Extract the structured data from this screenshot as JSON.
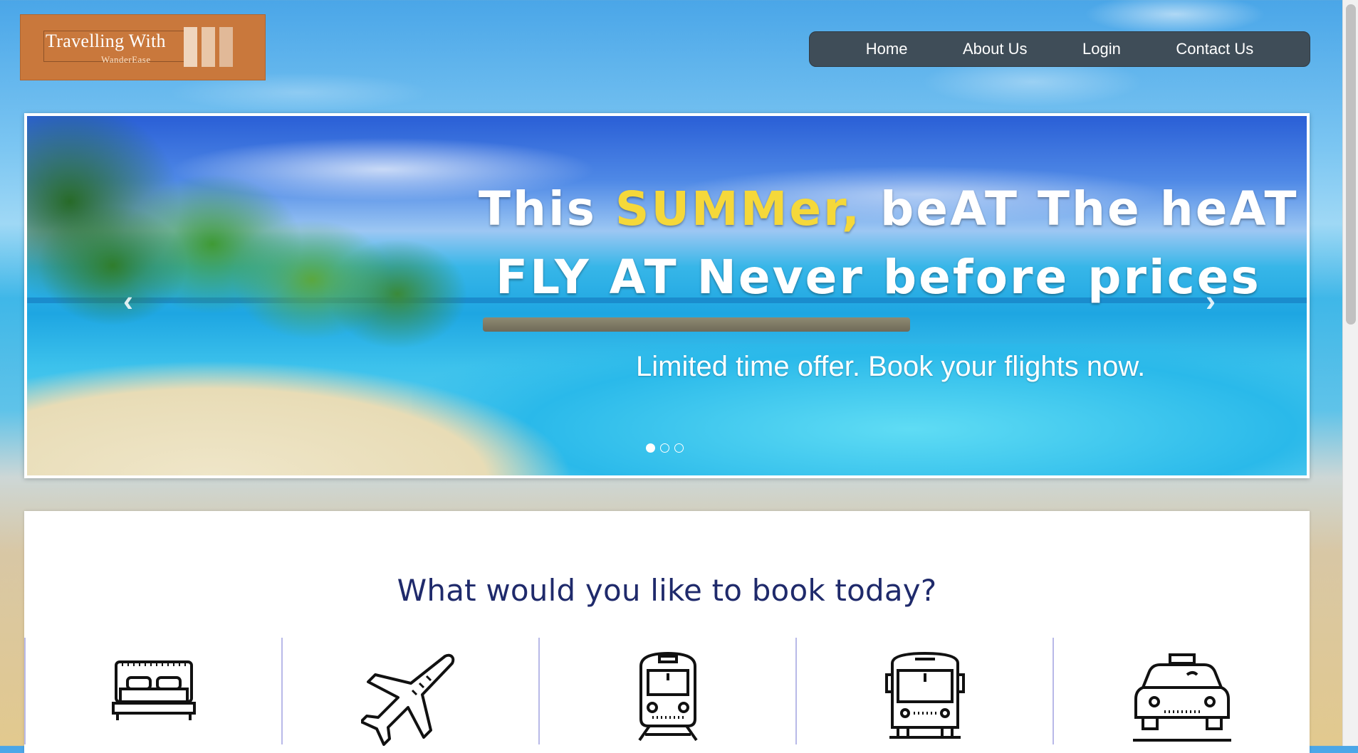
{
  "logo": {
    "title": "Travelling With",
    "subtitle": "WanderEase"
  },
  "nav": {
    "items": [
      {
        "label": "Home"
      },
      {
        "label": "About Us"
      },
      {
        "label": "Login"
      },
      {
        "label": "Contact Us"
      }
    ]
  },
  "carousel": {
    "headline_line1_a": "This ",
    "headline_line1_highlight": "SUMMer,",
    "headline_line1_b": " beAT The heAT",
    "headline_line2": "FLY AT Never before prices",
    "offer_text": "Limited time offer. Book your flights now.",
    "prev_arrow": "‹",
    "next_arrow": "›",
    "slide_count": 3,
    "active_slide": 1,
    "highlight_color": "#f5d83a"
  },
  "booking": {
    "title": "What would you like to book today?",
    "options": [
      {
        "icon": "bed-icon"
      },
      {
        "icon": "airplane-icon"
      },
      {
        "icon": "train-icon"
      },
      {
        "icon": "bus-icon"
      },
      {
        "icon": "taxi-icon"
      }
    ]
  },
  "colors": {
    "nav_bg": "#3f4d58",
    "logo_bg": "#c9783c",
    "title_color": "#1f2a6b",
    "divider": "#b8b9e8"
  }
}
